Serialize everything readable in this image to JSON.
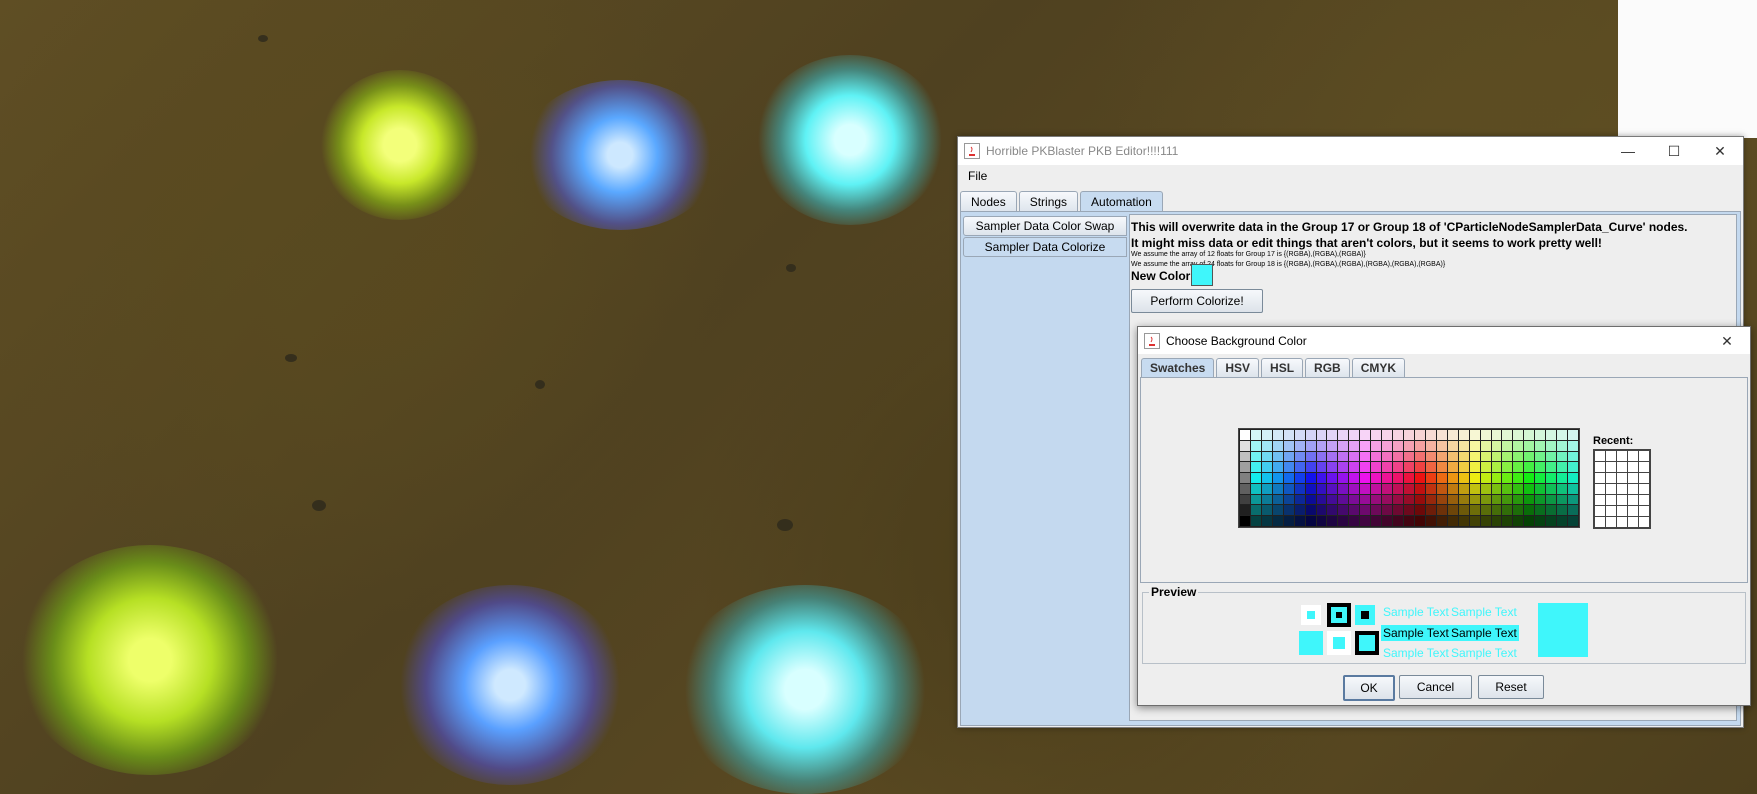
{
  "main_window": {
    "title": "Horrible PKBlaster PKB Editor!!!!111",
    "menu": [
      "File"
    ],
    "tabs": [
      "Nodes",
      "Strings",
      "Automation"
    ],
    "selected_tab": "Automation",
    "side_tabs": [
      "Sampler Data Color Swap",
      "Sampler Data Colorize"
    ],
    "selected_side_tab": "Sampler Data Colorize",
    "content": {
      "line1": "This will overwrite data in the Group 17 or Group 18 of 'CParticleNodeSamplerData_Curve' nodes.",
      "line2": "It might miss data or edit things that aren't colors, but it seems to work pretty well!",
      "note1": "We assume the array of 12 floats for Group 17 is {(RGBA),(RGBA),(RGBA)}",
      "note2": "We assume the array of 24 floats for Group 18 is {(RGBA),(RGBA),(RGBA),(RGBA),(RGBA),(RGBA)}",
      "new_color_label": "New Color:",
      "new_color": "#3ff6fb",
      "perform_button": "Perform Colorize!"
    }
  },
  "color_dialog": {
    "title": "Choose Background Color",
    "tabs": [
      "Swatches",
      "HSV",
      "HSL",
      "RGB",
      "CMYK"
    ],
    "selected_tab": "Swatches",
    "recent_label": "Recent:",
    "preview_label": "Preview",
    "sample_text": "Sample Text",
    "selected_color": "#3ff6fb",
    "buttons": {
      "ok": "OK",
      "cancel": "Cancel",
      "reset": "Reset"
    }
  },
  "icons": [
    "java-icon",
    "minimize-icon",
    "maximize-icon",
    "close-icon"
  ]
}
